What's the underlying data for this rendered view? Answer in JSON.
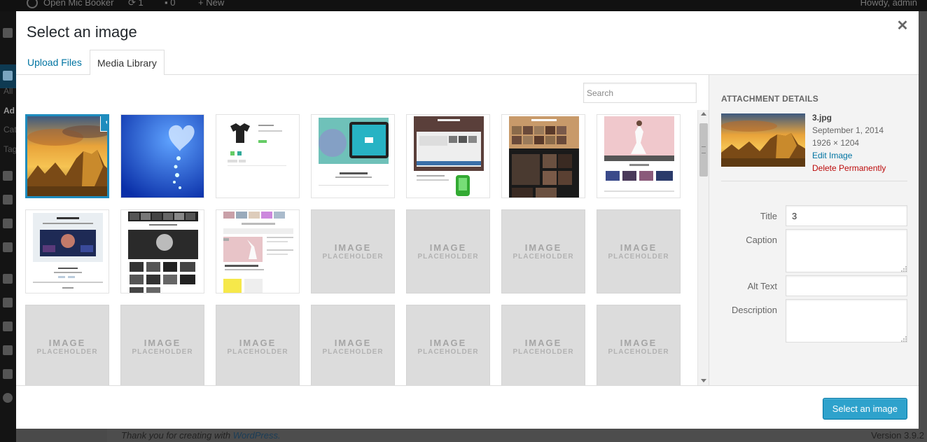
{
  "admin_bar": {
    "site_name": "Open Mic Booker",
    "updates_count": "1",
    "comments_count": "0",
    "new_label": "New",
    "greeting": "Howdy, admin"
  },
  "admin_menu_fragments": [
    "All",
    "Ad",
    "Cat",
    "Tag"
  ],
  "footer": {
    "thanks_text": "Thank you for creating with",
    "wordpress_link": "WordPress.",
    "version": "Version 3.9.2"
  },
  "modal": {
    "title": "Select an image",
    "close_icon": "close-icon",
    "tabs": [
      {
        "label": "Upload Files",
        "active": false
      },
      {
        "label": "Media Library",
        "active": true
      }
    ],
    "search": {
      "placeholder": "Search",
      "value": ""
    },
    "placeholder_text": {
      "big": "IMAGE",
      "small": "PLACEHOLDER"
    },
    "attachments": [
      {
        "kind": "sunset-rocks-photo",
        "selected": true
      },
      {
        "kind": "blue-heart-photo",
        "selected": false
      },
      {
        "kind": "tshirt-shop-screenshot",
        "selected": false
      },
      {
        "kind": "tablet-theme-screenshot",
        "selected": false
      },
      {
        "kind": "welcome-theme-screenshot",
        "selected": false
      },
      {
        "kind": "photo-page-screenshot",
        "selected": false
      },
      {
        "kind": "winter-bride-screenshot",
        "selected": false
      },
      {
        "kind": "welcome-concert-screenshot",
        "selected": false
      },
      {
        "kind": "bw-portfolio-screenshot",
        "selected": false
      },
      {
        "kind": "wedding-dress-screenshot",
        "selected": false
      },
      {
        "kind": "placeholder"
      },
      {
        "kind": "placeholder"
      },
      {
        "kind": "placeholder"
      },
      {
        "kind": "placeholder"
      },
      {
        "kind": "placeholder"
      },
      {
        "kind": "placeholder"
      },
      {
        "kind": "placeholder"
      },
      {
        "kind": "placeholder"
      },
      {
        "kind": "placeholder"
      },
      {
        "kind": "placeholder"
      },
      {
        "kind": "placeholder"
      }
    ],
    "details": {
      "heading": "ATTACHMENT DETAILS",
      "filename": "3.jpg",
      "date": "September 1, 2014",
      "dimensions": "1926 × 1204",
      "edit_link": "Edit Image",
      "delete_link": "Delete Permanently",
      "fields": {
        "title_label": "Title",
        "title_value": "3",
        "caption_label": "Caption",
        "caption_value": "",
        "alt_label": "Alt Text",
        "alt_value": "",
        "description_label": "Description",
        "description_value": ""
      }
    },
    "select_button": "Select an image"
  },
  "colors": {
    "accent": "#1e8cbe",
    "link": "#0074a2",
    "delete": "#bc0b0b",
    "primary_button": "#2ea2cc"
  }
}
